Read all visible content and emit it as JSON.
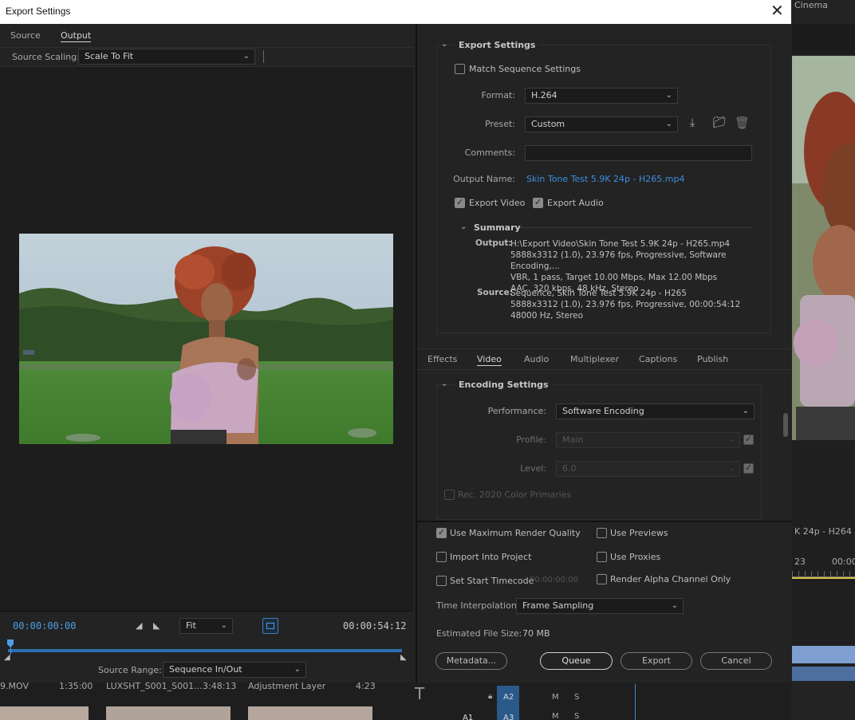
{
  "dialog": {
    "title": "Export Settings",
    "close_glyph": "✕"
  },
  "left": {
    "tabs": [
      "Source",
      "Output"
    ],
    "active_tab": "Output",
    "source_scaling_label": "Source Scaling:",
    "source_scaling_value": "Scale To Fit",
    "current_timecode": "00:00:00:00",
    "duration_timecode": "00:00:54:12",
    "zoom_value": "Fit",
    "source_range_label": "Source Range:",
    "source_range_value": "Sequence In/Out"
  },
  "export_settings": {
    "header": "Export Settings",
    "match_sequence": "Match Sequence Settings",
    "format_label": "Format:",
    "format_value": "H.264",
    "preset_label": "Preset:",
    "preset_value": "Custom",
    "comments_label": "Comments:",
    "comments_value": "",
    "output_name_label": "Output Name:",
    "output_name_value": "Skin Tone Test 5.9K 24p  - H265.mp4",
    "export_video": "Export Video",
    "export_audio": "Export Audio",
    "summary_header": "Summary",
    "summary_output_label": "Output:",
    "summary_output_lines": [
      "H:\\Export Video\\Skin Tone Test 5.9K 24p  - H265.mp4",
      "5888x3312 (1.0), 23.976 fps, Progressive, Software Encoding,...",
      "VBR, 1 pass, Target 10.00 Mbps, Max 12.00 Mbps",
      "AAC, 320 kbps, 48 kHz, Stereo"
    ],
    "summary_source_label": "Source:",
    "summary_source_lines": [
      "Sequence, Skin Tone Test 5.9K 24p  - H265",
      "5888x3312 (1.0), 23.976 fps, Progressive, 00:00:54:12",
      "48000 Hz, Stereo"
    ]
  },
  "settings_tabs": [
    "Effects",
    "Video",
    "Audio",
    "Multiplexer",
    "Captions",
    "Publish"
  ],
  "active_settings_tab": "Video",
  "encoding": {
    "header": "Encoding Settings",
    "performance_label": "Performance:",
    "performance_value": "Software Encoding",
    "profile_label": "Profile:",
    "profile_value": "Main",
    "level_label": "Level:",
    "level_value": "6.0",
    "rec2020_label": "Rec. 2020 Color Primaries"
  },
  "bottom": {
    "max_render_quality": "Use Maximum Render Quality",
    "use_previews": "Use Previews",
    "import_into_project": "Import Into Project",
    "use_proxies": "Use Proxies",
    "set_start_timecode": "Set Start Timecode",
    "start_timecode_value": "00:00:00:00",
    "render_alpha": "Render Alpha Channel Only",
    "time_interp_label": "Time Interpolation:",
    "time_interp_value": "Frame Sampling",
    "est_size_label": "Estimated File Size:",
    "est_size_value": "70 MB",
    "metadata_btn": "Metadata...",
    "queue_btn": "Queue",
    "export_btn": "Export",
    "cancel_btn": "Cancel"
  },
  "background": {
    "cinema_text": "Cinema",
    "seq_text": "K 24p  - H264",
    "tc_a": "23",
    "tc_b": "00:00",
    "bin_items": [
      {
        "name": "9.MOV",
        "duration": "1:35:00"
      },
      {
        "name": "LUXSHT_S001_S001...",
        "duration": "3:48:13"
      },
      {
        "name": "Adjustment Layer",
        "duration": "4:23"
      }
    ],
    "track_a2": "A2",
    "track_a1": "A1",
    "track_a3": "A3",
    "m_label": "M",
    "s_label": "S"
  },
  "colors": {
    "accent_blue": "#3e8ee0",
    "timecode_blue": "#4d9de6",
    "dialog_bg": "#232323"
  }
}
